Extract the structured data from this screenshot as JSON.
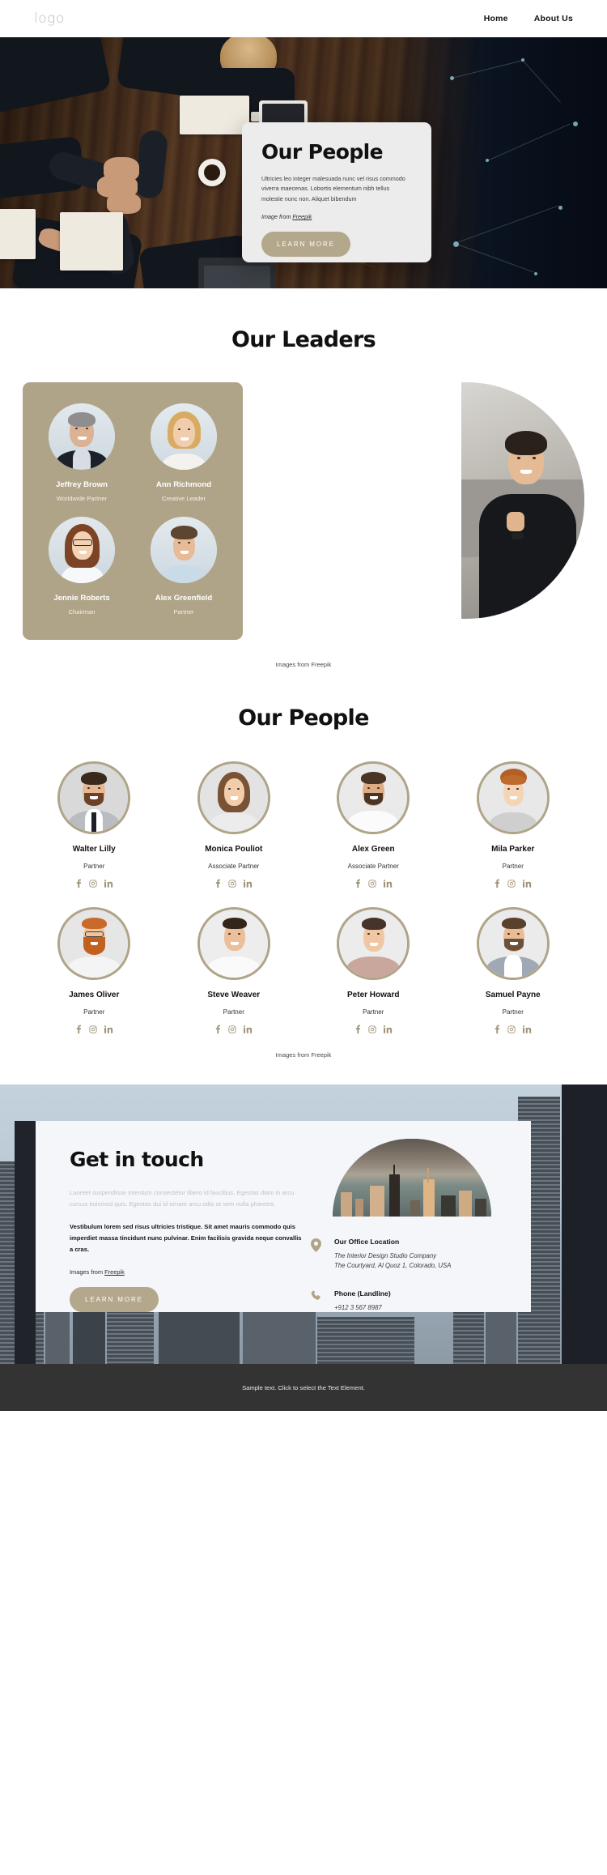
{
  "header": {
    "logo": "logo",
    "nav": [
      {
        "label": "Home"
      },
      {
        "label": "About Us"
      }
    ]
  },
  "hero": {
    "card": {
      "title": "Our People",
      "body": "Ultricies leo integer malesuada nunc vel risus commodo viverra maecenas. Lobortis elementum nibh tellus molestie nunc non. Aliquet bibendum",
      "credit_prefix": "Image from ",
      "credit_link": "Freepik",
      "button": "LEARN MORE"
    }
  },
  "leaders": {
    "title": "Our Leaders",
    "caption": "Images from Freepik",
    "items": [
      {
        "name": "Jeffrey Brown",
        "role": "Worldwide Partner"
      },
      {
        "name": "Ann Richmond",
        "role": "Creative Leader"
      },
      {
        "name": "Jennie Roberts",
        "role": "Chairman"
      },
      {
        "name": "Alex Greenfield",
        "role": "Partner"
      }
    ],
    "feature_photo_alt": "smiling-man-photo"
  },
  "people": {
    "title": "Our People",
    "caption": "Images from Freepik",
    "social_icons": [
      "facebook-icon",
      "instagram-icon",
      "linkedin-icon"
    ],
    "items": [
      {
        "name": "Walter Lilly",
        "role": "Partner"
      },
      {
        "name": "Monica Pouliot",
        "role": "Associate Partner"
      },
      {
        "name": "Alex Green",
        "role": "Associate Partner"
      },
      {
        "name": "Mila Parker",
        "role": "Partner"
      },
      {
        "name": "James Oliver",
        "role": "Partner"
      },
      {
        "name": "Steve Weaver",
        "role": "Partner"
      },
      {
        "name": "Peter Howard",
        "role": "Partner"
      },
      {
        "name": "Samuel Payne",
        "role": "Partner"
      }
    ]
  },
  "contact": {
    "title": "Get in touch",
    "muted_text": "Laoreet suspendisse interdum consectetur libero id faucibus. Egestas diam in arcu cursus euismod quis. Egestas dui id ornare arcu odio ut sem nulla pharetra.",
    "bold_text": "Vestibulum lorem sed risus ultricies tristique. Sit amet mauris commodo quis imperdiet massa tincidunt nunc pulvinar. Enim facilisis gravida neque convallis a cras.",
    "credit_prefix": "Images from ",
    "credit_link": "Freepik",
    "button": "LEARN MORE",
    "office": {
      "icon": "map-pin-icon",
      "title": "Our Office Location",
      "line1": "The Interior Design Studio Company",
      "line2": "The Courtyard, Al Quoz 1, Colorado,  USA"
    },
    "phone": {
      "icon": "phone-icon",
      "title": "Phone (Landline)",
      "number": "+912 3 567 8987"
    }
  },
  "footer": {
    "text": "Sample text. Click to select the Text Element."
  },
  "colors": {
    "accent": "#b0a488",
    "button": "#b3a78c",
    "card_bg": "#ececec",
    "contact_card_bg": "#f4f6f9",
    "footer_bg": "#333333"
  }
}
